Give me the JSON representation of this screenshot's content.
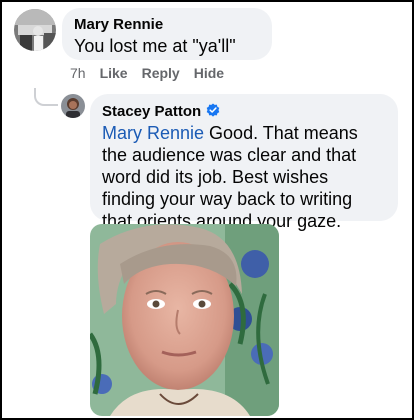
{
  "comment": {
    "author": "Mary Rennie",
    "text": "You lost me at \"ya'll\"",
    "time": "7h",
    "actions": {
      "like": "Like",
      "reply": "Reply",
      "hide": "Hide"
    }
  },
  "reply": {
    "author": "Stacey Patton",
    "mention": "Mary Rennie",
    "text": " Good. That means the audience was clear and that word did its job. Best wishes finding your way back to writing that orients around your gaze.",
    "verified_badge_icon": "verified-badge-icon",
    "attachment": "photo"
  },
  "colors": {
    "bubble": "#f0f2f5",
    "mention": "#1b5bb5",
    "meta": "#65676b",
    "verified": "#1877f2"
  }
}
